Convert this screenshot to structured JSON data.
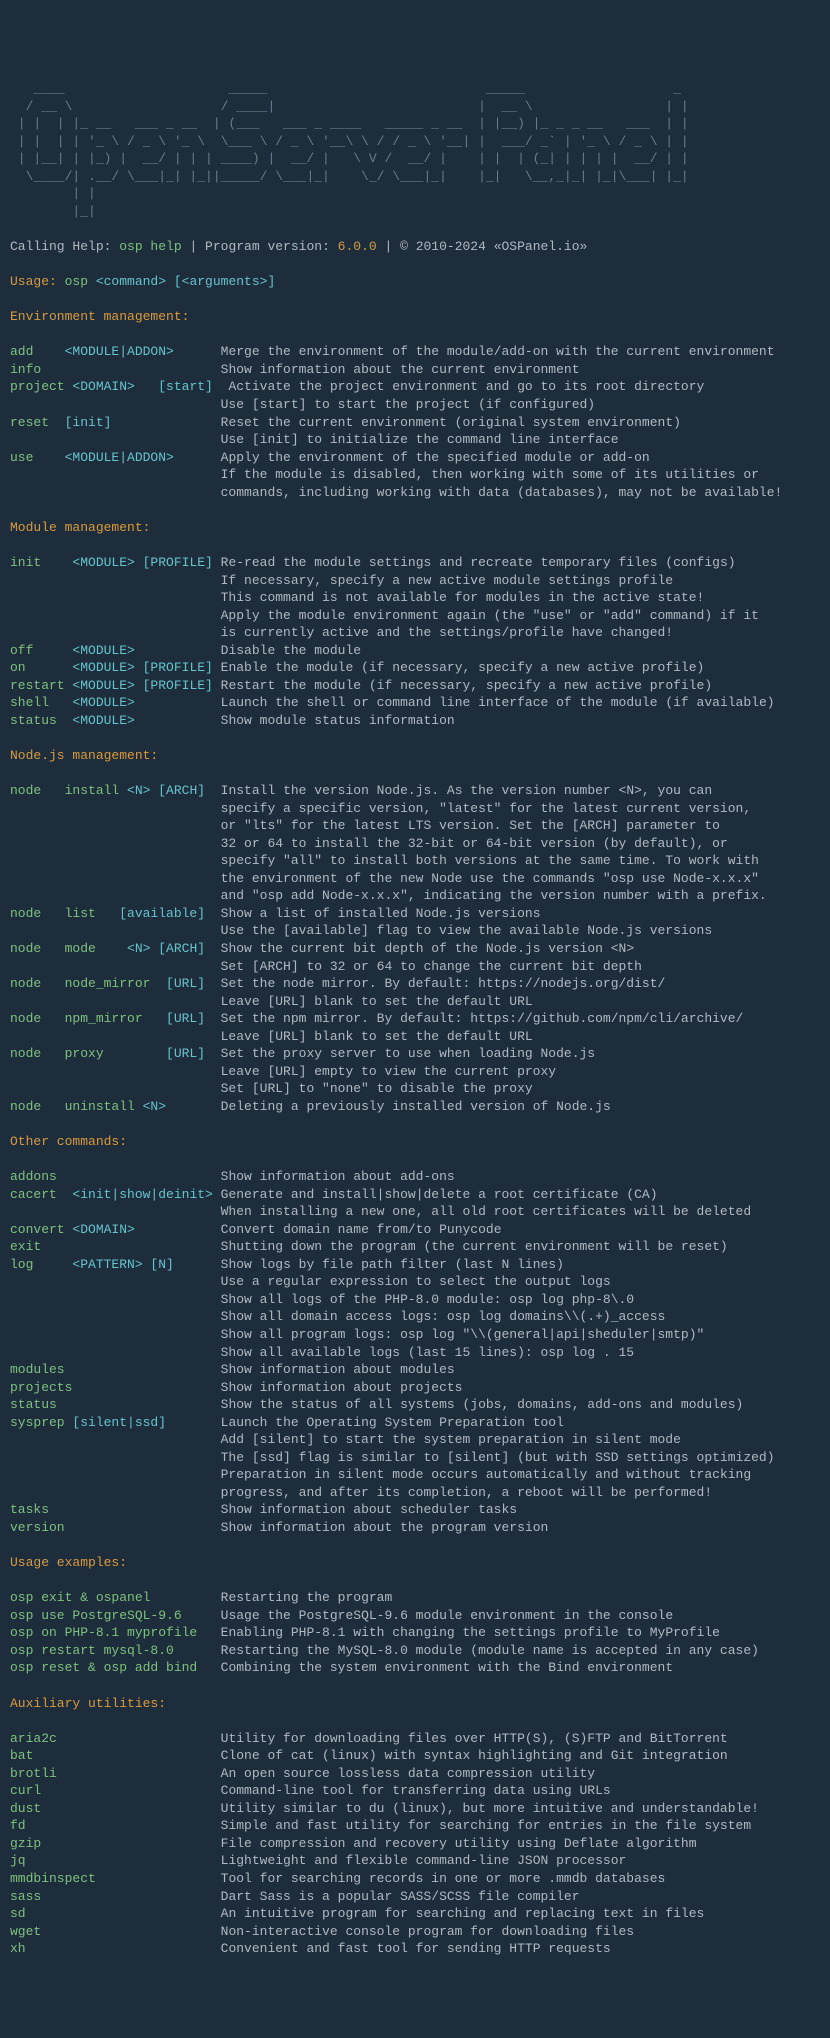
{
  "ascii": "   ____                     _____                            _____                   _\n  / __ \\                   / ____|                          |  __ \\                 | |\n | |  | |_ __   ___ _ __  | (___   ___ _ ____   _____ _ __  | |__) |_ _ _ __   ___  | |\n | |  | | '_ \\ / _ \\ '_ \\  \\___ \\ / _ \\ '__\\ \\ / / _ \\ '__| |  ___/ _` | '_ \\ / _ \\ | |\n | |__| | |_) |  __/ | | | ____) |  __/ |   \\ V /  __/ |    | |  | (_| | | | |  __/ | |\n  \\____/| .__/ \\___|_| |_||_____/ \\___|_|    \\_/ \\___|_|    |_|   \\__,_|_| |_|\\___| |_|\n        | |\n        |_|",
  "header": {
    "calling_help": "Calling Help:",
    "osp_help": " osp help",
    "sep1": " | ",
    "program_version": "Program version:",
    "version": " 6.0.0",
    "sep2": " | ",
    "copyright": "© 2010-2024 «OSPanel.io»"
  },
  "usage": {
    "label": "Usage:",
    "cmd": " osp ",
    "command": "<command>",
    "args": " [<arguments>]"
  },
  "sections": {
    "env": "Environment management:",
    "module": "Module management:",
    "node": "Node.js management:",
    "other": "Other commands:",
    "examples": "Usage examples:",
    "aux": "Auxiliary utilities:"
  },
  "env": {
    "add": {
      "cmd": "add    ",
      "arg": "<MODULE|ADDON>      ",
      "desc": "Merge the environment of the module/add-on with the current environment"
    },
    "info": {
      "cmd": "info                       ",
      "desc": "Show information about the current environment"
    },
    "project": {
      "cmd": "project",
      "arg1": " <DOMAIN>   ",
      "arg2": "[start]  ",
      "desc1": "Activate the project environment and go to its root directory",
      "desc2": "                           Use [start] to start the project (if configured)"
    },
    "reset": {
      "cmd": "reset  ",
      "arg": "[init]              ",
      "desc1": "Reset the current environment (original system environment)",
      "desc2": "                           Use [init] to initialize the command line interface"
    },
    "use": {
      "cmd": "use    ",
      "arg": "<MODULE|ADDON>      ",
      "desc1": "Apply the environment of the specified module or add-on",
      "desc2": "                           If the module is disabled, then working with some of its utilities or",
      "desc3": "                           commands, including working with data (databases), may not be available!"
    }
  },
  "module": {
    "init": {
      "cmd": "init    ",
      "arg": "<MODULE> [PROFILE] ",
      "d1": "Re-read the module settings and recreate temporary files (configs)",
      "d2": "                           If necessary, specify a new active module settings profile",
      "d3": "                           This command is not available for modules in the active state!",
      "d4": "                           Apply the module environment again (the \"use\" or \"add\" command) if it",
      "d5": "                           is currently active and the settings/profile have changed!"
    },
    "off": {
      "cmd": "off     ",
      "arg": "<MODULE>           ",
      "desc": "Disable the module"
    },
    "on": {
      "cmd": "on      ",
      "arg": "<MODULE> [PROFILE] ",
      "desc": "Enable the module (if necessary, specify a new active profile)"
    },
    "restart": {
      "cmd": "restart ",
      "arg": "<MODULE> [PROFILE] ",
      "desc": "Restart the module (if necessary, specify a new active profile)"
    },
    "shell": {
      "cmd": "shell   ",
      "arg": "<MODULE>           ",
      "desc": "Launch the shell or command line interface of the module (if available)"
    },
    "status": {
      "cmd": "status  ",
      "arg": "<MODULE>           ",
      "desc": "Show module status information"
    }
  },
  "node": {
    "install": {
      "cmd": "node   ",
      "sub": "install ",
      "arg": "<N> [ARCH]  ",
      "d1": "Install the version Node.js. As the version number <N>, you can",
      "d2": "                           specify a specific version, \"latest\" for the latest current version,",
      "d3": "                           or \"lts\" for the latest LTS version. Set the [ARCH] parameter to",
      "d4": "                           32 or 64 to install the 32-bit or 64-bit version (by default), or",
      "d5": "                           specify \"all\" to install both versions at the same time. To work with",
      "d6": "                           the environment of the new Node use the commands \"osp use Node-x.x.x\"",
      "d7": "                           and \"osp add Node-x.x.x\", indicating the version number with a prefix."
    },
    "list": {
      "cmd": "node   ",
      "sub": "list   ",
      "arg": "[available]  ",
      "d1": "Show a list of installed Node.js versions",
      "d2": "                           Use the [available] flag to view the available Node.js versions"
    },
    "mode": {
      "cmd": "node   ",
      "sub": "mode    ",
      "arg": "<N> [ARCH]  ",
      "d1": "Show the current bit depth of the Node.js version <N>",
      "d2": "                           Set [ARCH] to 32 or 64 to change the current bit depth"
    },
    "nodemirror": {
      "cmd": "node   ",
      "sub": "node_mirror  ",
      "arg": "[URL]  ",
      "d1": "Set the node mirror. By default: https://nodejs.org/dist/",
      "d2": "                           Leave [URL] blank to set the default URL"
    },
    "npmmirror": {
      "cmd": "node   ",
      "sub": "npm_mirror   ",
      "arg": "[URL]  ",
      "d1": "Set the npm mirror. By default: https://github.com/npm/cli/archive/",
      "d2": "                           Leave [URL] blank to set the default URL"
    },
    "proxy": {
      "cmd": "node   ",
      "sub": "proxy        ",
      "arg": "[URL]  ",
      "d1": "Set the proxy server to use when loading Node.js",
      "d2": "                           Leave [URL] empty to view the current proxy",
      "d3": "                           Set [URL] to \"none\" to disable the proxy"
    },
    "uninstall": {
      "cmd": "node   ",
      "sub": "uninstall ",
      "arg": "<N>       ",
      "d1": "Deleting a previously installed version of Node.js"
    }
  },
  "other": {
    "addons": {
      "cmd": "addons                     ",
      "desc": "Show information about add-ons"
    },
    "cacert": {
      "cmd": "cacert  ",
      "arg": "<init|show|deinit> ",
      "d1": "Generate and install|show|delete a root certificate (CA)",
      "d2": "                           When installing a new one, all old root certificates will be deleted"
    },
    "convert": {
      "cmd": "convert ",
      "arg": "<DOMAIN>           ",
      "desc": "Convert domain name from/to Punycode"
    },
    "exit": {
      "cmd": "exit                       ",
      "desc": "Shutting down the program (the current environment will be reset)"
    },
    "log": {
      "cmd": "log     ",
      "arg": "<PATTERN> [N]      ",
      "d1": "Show logs by file path filter (last N lines)",
      "d2": "                           Use a regular expression to select the output logs",
      "d3": "                           Show all logs of the PHP-8.0 module: osp log php-8\\.0",
      "d4": "                           Show all domain access logs: osp log domains\\\\(.+)_access",
      "d5": "                           Show all program logs: osp log \"\\\\(general|api|sheduler|smtp)\"",
      "d6": "                           Show all available logs (last 15 lines): osp log . 15"
    },
    "modules": {
      "cmd": "modules                    ",
      "desc": "Show information about modules"
    },
    "projects": {
      "cmd": "projects                   ",
      "desc": "Show information about projects"
    },
    "status": {
      "cmd": "status                     ",
      "desc": "Show the status of all systems (jobs, domains, add-ons and modules)"
    },
    "sysprep": {
      "cmd": "sysprep ",
      "arg": "[silent|ssd]       ",
      "d1": "Launch the Operating System Preparation tool",
      "d2": "                           Add [silent] to start the system preparation in silent mode",
      "d3": "                           The [ssd] flag is similar to [silent] (but with SSD settings optimized)",
      "d4": "                           Preparation in silent mode occurs automatically and without tracking",
      "d5": "                           progress, and after its completion, a reboot will be performed!"
    },
    "tasks": {
      "cmd": "tasks                      ",
      "desc": "Show information about scheduler tasks"
    },
    "version": {
      "cmd": "version                    ",
      "desc": "Show information about the program version"
    }
  },
  "examples": {
    "e1": {
      "cmd": "osp exit & ospanel         ",
      "desc": "Restarting the program"
    },
    "e2": {
      "cmd": "osp use PostgreSQL-9.6     ",
      "desc": "Usage the PostgreSQL-9.6 module environment in the console"
    },
    "e3": {
      "cmd": "osp on PHP-8.1 myprofile   ",
      "desc": "Enabling PHP-8.1 with changing the settings profile to MyProfile"
    },
    "e4": {
      "cmd": "osp restart mysql-8.0      ",
      "desc": "Restarting the MySQL-8.0 module (module name is accepted in any case)"
    },
    "e5": {
      "cmd": "osp reset & osp add bind   ",
      "desc": "Combining the system environment with the Bind environment"
    }
  },
  "aux": {
    "aria2c": {
      "cmd": "aria2c                     ",
      "desc": "Utility for downloading files over HTTP(S), (S)FTP and BitTorrent"
    },
    "bat": {
      "cmd": "bat                        ",
      "desc": "Clone of cat (linux) with syntax highlighting and Git integration"
    },
    "brotli": {
      "cmd": "brotli                     ",
      "desc": "An open source lossless data compression utility"
    },
    "curl": {
      "cmd": "curl                       ",
      "desc": "Command-line tool for transferring data using URLs"
    },
    "dust": {
      "cmd": "dust                       ",
      "desc": "Utility similar to du (linux), but more intuitive and understandable!"
    },
    "fd": {
      "cmd": "fd                         ",
      "desc": "Simple and fast utility for searching for entries in the file system"
    },
    "gzip": {
      "cmd": "gzip                       ",
      "desc": "File compression and recovery utility using Deflate algorithm"
    },
    "jq": {
      "cmd": "jq                         ",
      "desc": "Lightweight and flexible command-line JSON processor"
    },
    "mmdbinspect": {
      "cmd": "mmdbinspect                ",
      "desc": "Tool for searching records in one or more .mmdb databases"
    },
    "sass": {
      "cmd": "sass                       ",
      "desc": "Dart Sass is a popular SASS/SCSS file compiler"
    },
    "sd": {
      "cmd": "sd                         ",
      "desc": "An intuitive program for searching and replacing text in files"
    },
    "wget": {
      "cmd": "wget                       ",
      "desc": "Non-interactive console program for downloading files"
    },
    "xh": {
      "cmd": "xh                         ",
      "desc": "Convenient and fast tool for sending HTTP requests"
    }
  }
}
